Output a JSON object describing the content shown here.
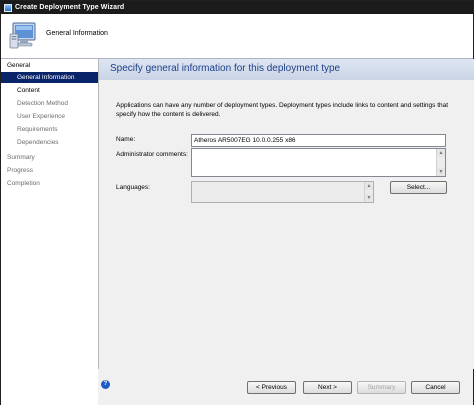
{
  "window": {
    "title": "Create Deployment Type Wizard"
  },
  "header": {
    "page_label": "General Information",
    "icon": "computer-wizard-icon"
  },
  "nav": [
    {
      "label": "General",
      "level": "section",
      "state": "active"
    },
    {
      "label": "General Information",
      "level": "sub",
      "state": "selected"
    },
    {
      "label": "Content",
      "level": "sub",
      "state": "normal"
    },
    {
      "label": "Detection Method",
      "level": "sub",
      "state": "inactive"
    },
    {
      "label": "User Experience",
      "level": "sub",
      "state": "inactive"
    },
    {
      "label": "Requirements",
      "level": "sub",
      "state": "inactive"
    },
    {
      "label": "Dependencies",
      "level": "sub",
      "state": "inactive"
    },
    {
      "label": "Summary",
      "level": "section",
      "state": "inactive"
    },
    {
      "label": "Progress",
      "level": "section",
      "state": "inactive"
    },
    {
      "label": "Completion",
      "level": "section",
      "state": "inactive"
    }
  ],
  "main": {
    "title": "Specify general information for this deployment type",
    "description": "Applications can have any number of deployment types. Deployment types include links to content and settings that specify how the content is delivered.",
    "name_label": "Name:",
    "name_value": "Atheros AR5007EG 10.0.0.255 x86",
    "admin_comments_label": "Administrator comments:",
    "admin_comments_value": "",
    "languages_label": "Languages:",
    "select_button": "Select..."
  },
  "footer": {
    "previous": "< Previous",
    "next": "Next >",
    "summary": "Summary",
    "cancel": "Cancel",
    "help_icon": "help-icon"
  },
  "colors": {
    "nav_selected": "#0a246a",
    "title_text": "#1f3f8a",
    "titlebar": "#1b1b1b"
  }
}
